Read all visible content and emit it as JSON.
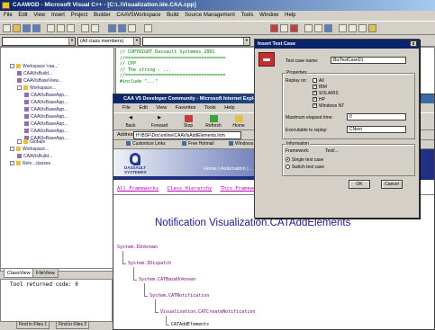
{
  "ide": {
    "title": "CAAWGD - Microsoft Visual C++ - [C:\\..\\Visualization.ide.CAA.cpp]",
    "menu": [
      "File",
      "Edit",
      "View",
      "Insert",
      "Project",
      "Builder",
      "CAAV5Workspace",
      "Build",
      "Source Management",
      "Tools",
      "Window",
      "Help"
    ],
    "class_combo": "(All class members)"
  },
  "workspace": {
    "tree": [
      "Workspace 'caa...'",
      "CAAVisBuild...",
      "CAAVisBaseView...",
      "Workspace...",
      "CAAVisBaseApp...",
      "CAAVisBaseApp...",
      "CAAVisBaseApp...",
      "CAAVisBaseApp...",
      "CAAVisBaseApp...",
      "CAAVisBaseApp...",
      "CAAVisBaseApp...",
      "Globals",
      "Workspace...",
      "CAAVisBuild...",
      "Rein...classes"
    ],
    "tabs": [
      "ClassView",
      "FileView"
    ]
  },
  "editor": {
    "lines": [
      "// COPYRIGHT Dassault Systemes 2001",
      "//=====================================",
      "// CPP",
      "// The string - ...",
      "//=====================================",
      "",
      "#include \"...\""
    ]
  },
  "browser": {
    "title": "CAA V5 Developer Community - Microsoft Internet Explorer",
    "menu": [
      "File",
      "Edit",
      "View",
      "Favorites",
      "Tools",
      "Help"
    ],
    "buttons": [
      "Back",
      "Forward",
      "Stop",
      "Refresh",
      "Home"
    ],
    "address_label": "Address",
    "address": "H:\\BSF\\Doc\\online\\CAAVisAddElements.htm",
    "links": [
      "Customize Links",
      "Free Hotmail",
      "Windows"
    ],
    "banner_left": "DASSAULT SYSTEMES",
    "banner_right": "Home | Automation | ...",
    "framework_links": [
      "All Frameworks",
      "Class Hierarchy",
      "This Framework"
    ],
    "page_title": "Notification Visualization.CATAddElements",
    "hierarchy": [
      "System.IUnknown",
      "System.IDispatch",
      "System.CATBaseUnknown",
      "System.CATNotification",
      "Visualization.CATCreateNotification",
      "CATAddElements"
    ]
  },
  "dialog": {
    "title": "Insert Test Case",
    "close": "x",
    "test_case_name_label": "Test case name:",
    "test_case_name": "BizTestCase01",
    "platforms_group": "Properties",
    "replay_on_label": "Replay on:",
    "platforms": [
      {
        "label": "All",
        "checked": false
      },
      {
        "label": "IBM",
        "checked": true
      },
      {
        "label": "SOLARIS",
        "checked": true
      },
      {
        "label": "HP",
        "checked": true
      },
      {
        "label": "Windows NT",
        "checked": true
      }
    ],
    "max_elapsed_label": "Maximum elapsed time:",
    "max_elapsed": "0",
    "executable_label": "Executable to replay:",
    "executable": "CNext",
    "info_group": "Information",
    "framework_label": "Framework:",
    "framework_value": "Test/...",
    "radio_options": [
      {
        "label": "Single test case",
        "selected": true
      },
      {
        "label": "Switch test case",
        "selected": false
      }
    ],
    "ok": "OK",
    "cancel": "Cancel"
  },
  "output": {
    "text": "Tool returned code: 0",
    "tabs": [
      "Find in Files 1",
      "Find in Files 2"
    ]
  },
  "colors": {
    "titlebar": "#0a246a",
    "link": "#800080",
    "page_title": "#1a1a8a"
  }
}
